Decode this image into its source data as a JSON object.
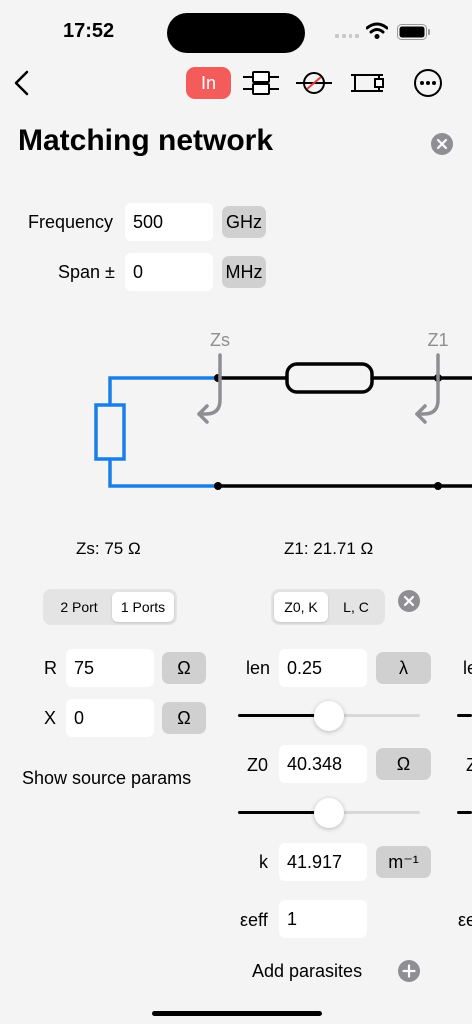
{
  "status": {
    "time": "17:52"
  },
  "nav": {
    "in_label": "In"
  },
  "title": "Matching network",
  "frequency": {
    "label": "Frequency",
    "value": "500",
    "unit": "GHz"
  },
  "span": {
    "label": "Span ±",
    "value": "0",
    "unit": "MHz"
  },
  "circuit": {
    "zs_tag": "Zs",
    "z1_tag": "Z1",
    "colors": {
      "source": "#1a7ee8",
      "line": "#000000",
      "marker": "#8e8e93"
    }
  },
  "impedances": {
    "zs": "Zs: 75 Ω",
    "z1": "Z1: 21.71 Ω"
  },
  "source": {
    "ports_seg": [
      "2 Port",
      "1 Ports"
    ],
    "selected_port": "1 Ports",
    "r": {
      "label": "R",
      "value": "75",
      "unit": "Ω"
    },
    "x": {
      "label": "X",
      "value": "0",
      "unit": "Ω"
    },
    "show_params": "Show source params"
  },
  "line": {
    "mode_seg": [
      "Z0, K",
      "L, C"
    ],
    "selected_mode": "Z0, K",
    "len": {
      "label": "len",
      "value": "0.25",
      "unit": "λ",
      "slider_fraction": 0.5
    },
    "z0": {
      "label": "Z0",
      "value": "40.348",
      "unit": "Ω",
      "slider_fraction": 0.5
    },
    "k": {
      "label": "k",
      "value": "41.917",
      "unit": "m⁻¹"
    },
    "eeff": {
      "label": "εeff",
      "value": "1"
    },
    "add_parasites": "Add parasites"
  },
  "next_column": {
    "len_label": "le",
    "z_label": "Z",
    "eps_label": "εe"
  }
}
